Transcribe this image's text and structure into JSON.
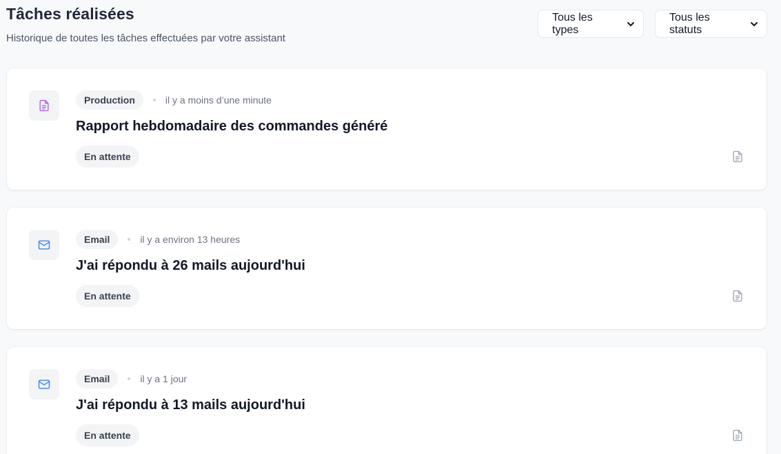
{
  "header": {
    "title": "Tâches réalisées",
    "subtitle": "Historique de toutes les tâches effectuées par votre assistant"
  },
  "filters": {
    "types": {
      "selected": "Tous les types",
      "icon": "chevron-down-icon"
    },
    "statuts": {
      "selected": "Tous les statuts",
      "icon": "chevron-down-icon"
    }
  },
  "tasks": [
    {
      "icon": "document-icon",
      "icon_color": "#a855f7",
      "type": "Production",
      "time": "il y a moins d’une minute",
      "title": "Rapport hebdomadaire des commandes généré",
      "status": "En attente",
      "action_icon": "document-icon"
    },
    {
      "icon": "mail-icon",
      "icon_color": "#3b82f6",
      "type": "Email",
      "time": "il y a environ 13 heures",
      "title": "J'ai répondu à 26 mails aujourd'hui",
      "status": "En attente",
      "action_icon": "document-icon"
    },
    {
      "icon": "mail-icon",
      "icon_color": "#3b82f6",
      "type": "Email",
      "time": "il y a 1 jour",
      "title": "J'ai répondu à 13 mails aujourd'hui",
      "status": "En attente",
      "action_icon": "document-icon"
    }
  ]
}
